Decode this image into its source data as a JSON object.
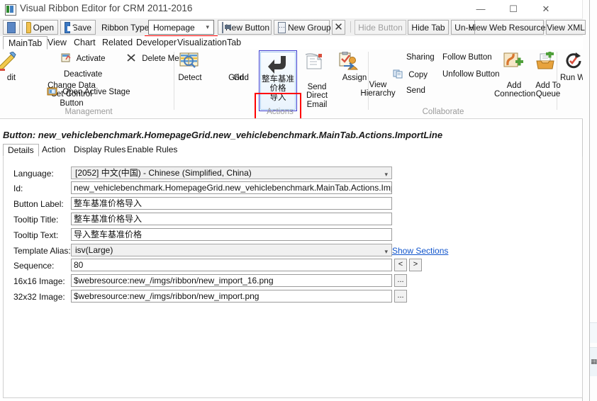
{
  "window": {
    "title": "Visual Ribbon Editor for CRM 2011-2016",
    "app_icon": "app-icon",
    "minimize": "—",
    "maximize": "☐",
    "close": "✕"
  },
  "toolbar": {
    "connect_icon": "connect-icon",
    "open_label": "Open",
    "save_label": "Save",
    "ribbon_type_label": "Ribbon Type:",
    "ribbon_type_value": "Homepage",
    "ribbon_type_options": [
      "Homepage"
    ],
    "new_button_label": "New Button",
    "new_group_label": "New Group",
    "delete_label": "✕",
    "hide_button_label": "Hide Button",
    "hide_tab_label": "Hide Tab",
    "unhide_label": "Un-Hi",
    "view_web_resources_label": "View Web Resources",
    "view_xml_label": "View XML"
  },
  "ribbon": {
    "tabs": [
      {
        "label": "MainTab",
        "selected": true
      },
      {
        "label": "View",
        "selected": false
      },
      {
        "label": "Chart",
        "selected": false
      },
      {
        "label": "Related",
        "selected": false
      },
      {
        "label": "Developer",
        "selected": false
      },
      {
        "label": "VisualizationTab",
        "selected": false
      }
    ],
    "groups": [
      {
        "title": "Management"
      },
      {
        "title": "Actions"
      },
      {
        "title": "Collaborate"
      }
    ],
    "large_buttons": [
      {
        "label": "dit",
        "icon": "edit-pencil-icon"
      },
      {
        "label": "Change Data\nSet Control\nButton",
        "icon": "none"
      },
      {
        "label": "Detect",
        "icon": "detect-duplicates-icon"
      },
      {
        "label": "Grid",
        "icon": "none"
      },
      {
        "label": "Grid",
        "icon": "none"
      },
      {
        "label": "整车基准价格\n导入",
        "icon": "import-arrow-icon",
        "selected": true
      },
      {
        "label": "Send Direct\nEmail",
        "icon": "send-email-icon"
      },
      {
        "label": "Assign",
        "icon": "assign-icon"
      },
      {
        "label": "View\nHierarchy",
        "icon": "none"
      },
      {
        "label": "Add\nConnection",
        "icon": "add-connection-icon"
      },
      {
        "label": "Add To\nQueue",
        "icon": "add-to-queue-icon"
      },
      {
        "label": "Run Workf",
        "icon": "run-workflow-icon"
      }
    ],
    "small_buttons": [
      {
        "label": "Activate",
        "icon": "activate-icon"
      },
      {
        "label": "Deactivate",
        "icon": "none"
      },
      {
        "label": "Open Active Stage",
        "icon": "open-active-stage-icon"
      },
      {
        "label": "Delete Menu",
        "icon": "delete-x-icon"
      },
      {
        "label": "Sharing",
        "icon": "none"
      },
      {
        "label": "Copy",
        "icon": "copy-icon"
      },
      {
        "label": "Send",
        "icon": "none"
      },
      {
        "label": "Follow Button",
        "icon": "none"
      },
      {
        "label": "Unfollow Button",
        "icon": "none"
      }
    ],
    "scroll_left": "‹",
    "scroll_right": "›"
  },
  "selection": {
    "path_text": "Button: new_vehiclebenchmark.HomepageGrid.new_vehiclebenchmark.MainTab.Actions.ImportLine"
  },
  "detail_tabs": [
    {
      "label": "Details",
      "selected": true
    },
    {
      "label": "Action",
      "selected": false
    },
    {
      "label": "Display Rules",
      "selected": false
    },
    {
      "label": "Enable Rules",
      "selected": false
    }
  ],
  "form": {
    "language": {
      "label": "Language:",
      "value": "[2052] 中文(中国) - Chinese (Simplified, China)"
    },
    "id": {
      "label": "Id:",
      "value": "new_vehiclebenchmark.HomepageGrid.new_vehiclebenchmark.MainTab.Actions.ImportLine"
    },
    "button_label": {
      "label": "Button Label:",
      "value": "整车基准价格导入"
    },
    "tooltip_title": {
      "label": "Tooltip Title:",
      "value": "整车基准价格导入"
    },
    "tooltip_text": {
      "label": "Tooltip Text:",
      "value": "导入整车基准价格"
    },
    "template_alias": {
      "label": "Template Alias:",
      "value": "isv(Large)",
      "link": "Show Sections"
    },
    "sequence": {
      "label": "Sequence:",
      "value": "80",
      "prev": "<",
      "next": ">"
    },
    "image16": {
      "label": "16x16 Image:",
      "value": "$webresource:new_/imgs/ribbon/new_import_16.png",
      "browse": "..."
    },
    "image32": {
      "label": "32x32 Image:",
      "value": "$webresource:new_/imgs/ribbon/new_import.png",
      "browse": "..."
    }
  },
  "colors": {
    "accent_red": "#ff0000",
    "selection_blue": "#3b3bd0",
    "link_blue": "#1155cc",
    "group_title_gray": "#9b9b9b"
  }
}
